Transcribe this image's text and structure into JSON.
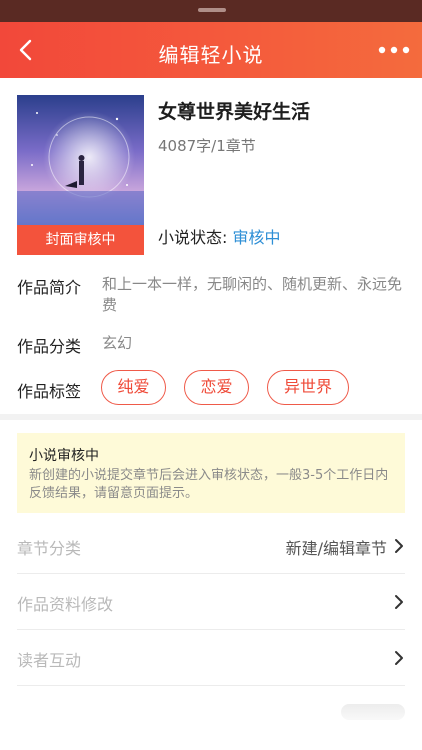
{
  "navbar": {
    "title": "编辑轻小说",
    "back_icon": "back-arrow-icon",
    "more_icon": "more-dots-icon"
  },
  "book": {
    "title": "女尊世界美好生活",
    "meta": "4087字/1章节",
    "cover_badge": "封面审核中",
    "status_label": "小说状态:",
    "status_value": "审核中"
  },
  "info": {
    "intro_label": "作品简介",
    "intro_value": "和上一本一样，无聊闲的、随机更新、永远免费",
    "category_label": "作品分类",
    "category_value": "玄幻",
    "tags_label": "作品标签",
    "tags": [
      "纯爱",
      "恋爱",
      "异世界"
    ]
  },
  "notice": {
    "title": "小说审核中",
    "text": "新创建的小说提交章节后会进入审核状态，一般3-5个工作日内反馈结果，请留意页面提示。"
  },
  "menu": [
    {
      "label": "章节分类",
      "value": "新建/编辑章节"
    },
    {
      "label": "作品资料修改",
      "value": ""
    },
    {
      "label": "读者互动",
      "value": ""
    }
  ],
  "colors": {
    "accent": "#f2483a",
    "status_blue": "#2e8fd6",
    "notice_bg": "#fefad8"
  }
}
